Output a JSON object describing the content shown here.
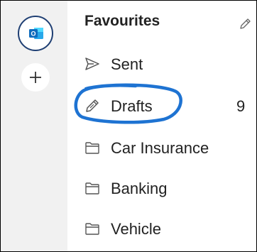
{
  "rail": {
    "account_icon": "outlook-icon",
    "add_icon": "plus-icon",
    "account_ring_color": "#1f3f73",
    "outlook_brand_color": "#0f6cbd"
  },
  "folders": {
    "header": "Favourites",
    "edit_icon": "pencil-icon",
    "items": [
      {
        "label": "Sent",
        "icon": "send-icon",
        "count": ""
      },
      {
        "label": "Drafts",
        "icon": "draft-pencil-icon",
        "count": "9"
      },
      {
        "label": "Car Insurance",
        "icon": "folder-icon",
        "count": ""
      },
      {
        "label": "Banking",
        "icon": "folder-icon",
        "count": ""
      },
      {
        "label": "Vehicle",
        "icon": "folder-icon",
        "count": ""
      }
    ]
  },
  "annotation": {
    "color": "#1e73d2",
    "description_icon": "hand-drawn-circle"
  }
}
